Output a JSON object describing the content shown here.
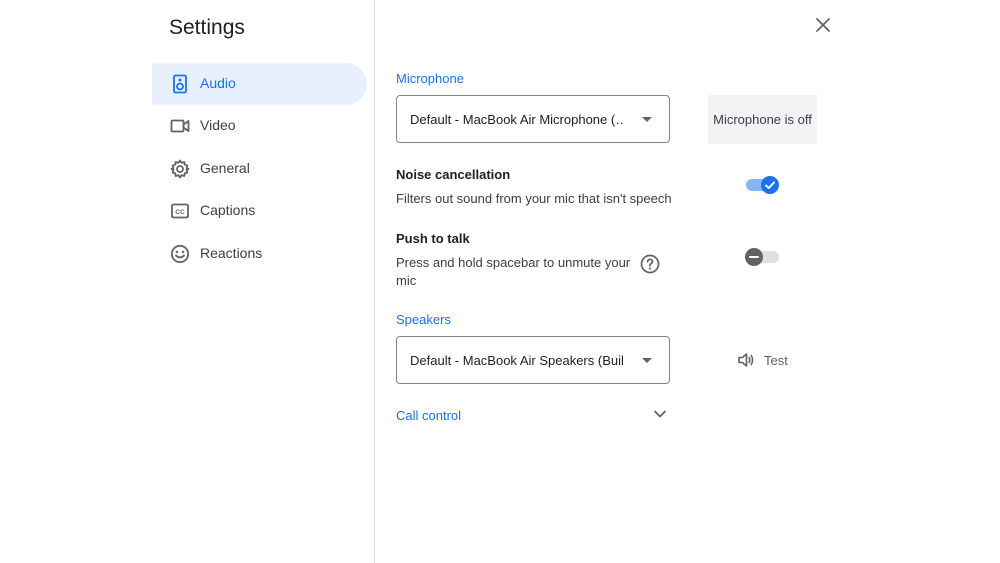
{
  "dialog": {
    "title": "Settings"
  },
  "nav": [
    {
      "label": "Audio",
      "icon": "speaker-icon",
      "active": true
    },
    {
      "label": "Video",
      "icon": "video-camera-icon"
    },
    {
      "label": "General",
      "icon": "gear-icon"
    },
    {
      "label": "Captions",
      "icon": "closed-captions-icon"
    },
    {
      "label": "Reactions",
      "icon": "smiley-icon"
    }
  ],
  "microphone": {
    "heading": "Microphone",
    "selected": "Default - MacBook Air Microphone (…",
    "status": "Microphone is off"
  },
  "noise_cancellation": {
    "title": "Noise cancellation",
    "description": "Filters out sound from your mic that isn't speech",
    "enabled": true
  },
  "push_to_talk": {
    "title": "Push to talk",
    "description_line1": "Press and hold spacebar to unmute your",
    "description_line2": "mic",
    "enabled": false
  },
  "speakers": {
    "heading": "Speakers",
    "selected": "Default - MacBook Air Speakers (Buil…",
    "test_label": "Test"
  },
  "call_control": {
    "heading": "Call control"
  },
  "colors": {
    "accent": "#1a73e8",
    "active_nav_bg": "#e8f0fe",
    "toggle_track_on": "#8ab4f8"
  }
}
